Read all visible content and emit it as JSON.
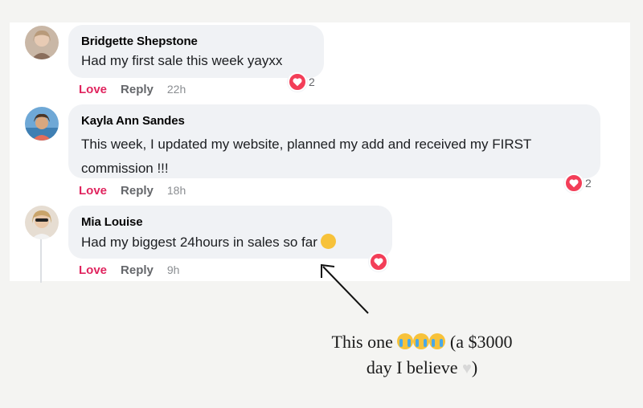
{
  "comments": [
    {
      "author": "Bridgette Shepstone",
      "text": "Had my first sale this week yayxx",
      "love_label": "Love",
      "reply_label": "Reply",
      "time": "22h",
      "reaction_count": "2",
      "avatar_icon": "avatar-photo"
    },
    {
      "author": "Kayla Ann Sandes",
      "text": "This week, I updated my website, planned my add and received my FIRST commission !!!",
      "love_label": "Love",
      "reply_label": "Reply",
      "time": "18h",
      "reaction_count": "2",
      "avatar_icon": "avatar-photo"
    },
    {
      "author": "Mia Louise",
      "text": "Had my biggest 24hours in sales so far",
      "love_label": "Love",
      "reply_label": "Reply",
      "time": "9h",
      "reaction_count": "",
      "avatar_icon": "avatar-photo"
    }
  ],
  "annotation": {
    "line1_prefix": "This one",
    "line1_suffix": "(a $3000",
    "line2": "day I believe",
    "line2_end": ")"
  },
  "colors": {
    "love": "#e0245e",
    "heart_reaction": "#f33e58",
    "bubble": "#f0f2f5"
  },
  "icons": [
    "heart-reaction-icon",
    "pleading-face-emoji",
    "loudly-crying-face-emoji",
    "white-heart-emoji",
    "arrow"
  ]
}
